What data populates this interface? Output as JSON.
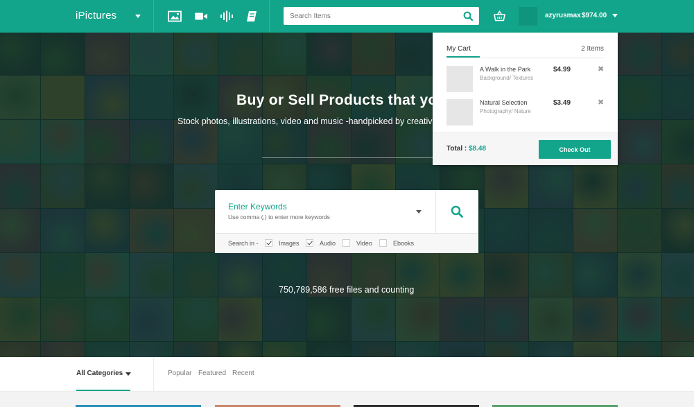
{
  "header": {
    "logo": "iPictures",
    "search_placeholder": "Search Items",
    "username": "azyrusmax",
    "balance": "$974.00"
  },
  "hero": {
    "title": "Buy or Sell Products that you",
    "subtitle": "Stock photos, illustrations, video and music -handpicked by creativ",
    "count_text": "750,789,586 free files and counting"
  },
  "keyword_search": {
    "title": "Enter Keywords",
    "hint": "Use comma (,) to enter more keywords",
    "search_in_label": "Search in -",
    "options": [
      {
        "label": "Images",
        "checked": true
      },
      {
        "label": "Audio",
        "checked": true
      },
      {
        "label": "Video",
        "checked": false
      },
      {
        "label": "Ebooks",
        "checked": false
      }
    ]
  },
  "cart": {
    "title": "My Cart",
    "count": "2 Items",
    "items": [
      {
        "name": "A Walk in the Park",
        "category": "Background/ Textures",
        "price": "$4.99",
        "remove": "✖"
      },
      {
        "name": "Natural Selection",
        "category": "Photography/ Nature",
        "price": "$3.49",
        "remove": "✖"
      }
    ],
    "total_label": "Total :",
    "total_value": "$8.48",
    "checkout_label": "Check Out"
  },
  "categories": {
    "all_label": "All Categories",
    "tabs": [
      "Popular",
      "Featured",
      "Recent"
    ]
  },
  "colors": {
    "brand": "#12a58b",
    "brand_dark": "#0f947d"
  },
  "icons": {
    "nav": [
      "image-icon",
      "video-camera-icon",
      "audio-waveform-icon",
      "ebook-icon"
    ],
    "search": "search-icon",
    "cart": "basket-icon"
  }
}
